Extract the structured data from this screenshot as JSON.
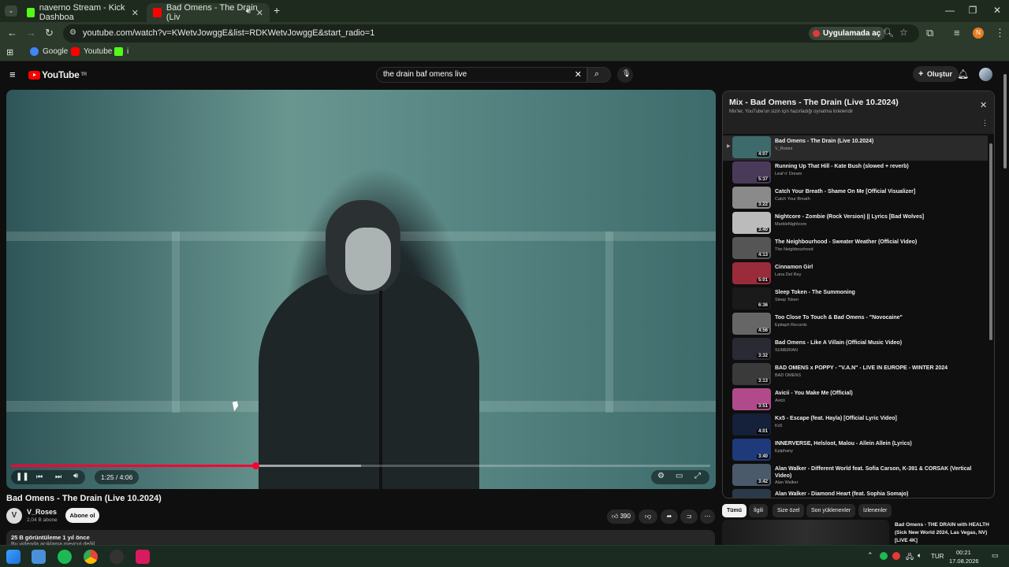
{
  "browser": {
    "tabs": [
      {
        "label": "naverno Stream - Kick Dashboa",
        "active": false,
        "favicon_color": "#53fc18"
      },
      {
        "label": "Bad Omens - The Drain (Liv",
        "active": true,
        "favicon_color": "#ff0000"
      }
    ],
    "url": "youtube.com/watch?v=KWetvJowggE&list=RDKWetvJowggE&start_radio=1",
    "open_in_app_label": "Uygulamada aç",
    "profile_initial": "N",
    "bookmarks": [
      {
        "label": "Google",
        "favicon_color": "#4285f4"
      },
      {
        "label": "Youtube",
        "favicon_color": "#ff0000"
      },
      {
        "label": "i",
        "favicon_color": "#53fc18"
      }
    ]
  },
  "youtube": {
    "logo_text": "YouTube",
    "region": "TR",
    "search_value": "the drain baf omens live",
    "create_label": "Oluştur"
  },
  "player": {
    "progress_fraction": 0.35,
    "buffered_fraction": 0.5,
    "time_text": "1:25 / 4:06"
  },
  "video": {
    "title": "Bad Omens - The Drain (Live 10.2024)",
    "channel": "V_Roses",
    "channel_initial": "V",
    "subscribers": "2,04 B abone",
    "subscribe_label": "Abone ol",
    "likes": "390",
    "views_line": "25 B görüntüleme  1 yıl önce",
    "description": "Bu videoda açıklama mevcut değil"
  },
  "playlist": {
    "title": "Mix - Bad Omens - The Drain (Live 10.2024)",
    "subtitle": "Mix'ler, YouTube'un sizin için hazırladığı oynatma listeleridir",
    "items": [
      {
        "title": "Bad Omens - The Drain (Live 10.2024)",
        "channel": "V_Roses",
        "duration": "4:07",
        "color": "#3d6b6b",
        "playing": true
      },
      {
        "title": "Running Up That Hill - Kate Bush (slowed + reverb)",
        "channel": "Leaf n' Dream",
        "duration": "5:37",
        "color": "#4a3a5a"
      },
      {
        "title": "Catch Your Breath - Shame On Me [Official Visualizer]",
        "channel": "Catch Your Breath",
        "duration": "3:22",
        "color": "#8a8a8a"
      },
      {
        "title": "Nightcore - Zombie (Rock Version) || Lyrics  [Bad Wolves]",
        "channel": "MarbleNightcore",
        "duration": "3:40",
        "color": "#bbbbbb"
      },
      {
        "title": "The Neighbourhood - Sweater Weather (Official Video)",
        "channel": "The Neighbourhood",
        "duration": "4:13",
        "color": "#555555"
      },
      {
        "title": "Cinnamon Girl",
        "channel": "Lana Del Rey",
        "duration": "5:01",
        "color": "#9a2b3a"
      },
      {
        "title": "Sleep Token - The Summoning",
        "channel": "Sleep Token",
        "duration": "6:36",
        "color": "#1a1a1a"
      },
      {
        "title": "Too Close To Touch & Bad Omens - \"Novocaine\"",
        "channel": "Epitaph Records",
        "duration": "4:56",
        "color": "#666666"
      },
      {
        "title": "Bad Omens - Like A Villain (Official Music Video)",
        "channel": "SUMERIAN",
        "duration": "3:32",
        "color": "#2a2a35"
      },
      {
        "title": "BAD OMENS x POPPY - \"V.A.N\" - LIVE IN EUROPE - WINTER 2024",
        "channel": "BAD OMENS",
        "duration": "3:13",
        "color": "#3a3a3a"
      },
      {
        "title": "Avicii - You Make Me (Official)",
        "channel": "Avicii",
        "duration": "3:51",
        "color": "#b04a8a"
      },
      {
        "title": "Kx5 - Escape (feat. Hayla) [Official Lyric Video]",
        "channel": "Kx5",
        "duration": "4:01",
        "color": "#15203a"
      },
      {
        "title": "INNERVERSE, Helsloot, Malou - Allein Allein (Lyrics)",
        "channel": "Epiphany",
        "duration": "3:40",
        "color": "#1e3a7a"
      },
      {
        "title": "Alan Walker - Different World feat. Sofia Carson, K-391 & CORSAK (Vertical Video)",
        "channel": "Alan Walker",
        "duration": "3:42",
        "color": "#4a5a6a"
      },
      {
        "title": "Alan Walker - Diamond Heart (feat. Sophia Somajo)",
        "channel": "",
        "duration": "",
        "color": "#2a3a4a"
      }
    ]
  },
  "chips": [
    {
      "label": "Tümü",
      "active": true
    },
    {
      "label": "İlgili",
      "active": false
    },
    {
      "label": "Size özel",
      "active": false
    },
    {
      "label": "Son yüklenenler",
      "active": false
    },
    {
      "label": "İzlenenler",
      "active": false
    }
  ],
  "recommendation": {
    "title": "Bad Omens - THE DRAIN with HEALTH (Sick New World 2024, Las Vegas, NV) [LIVE 4K]"
  },
  "taskbar": {
    "lang": "TUR",
    "time": "00:21",
    "date": "17.08.2026"
  }
}
